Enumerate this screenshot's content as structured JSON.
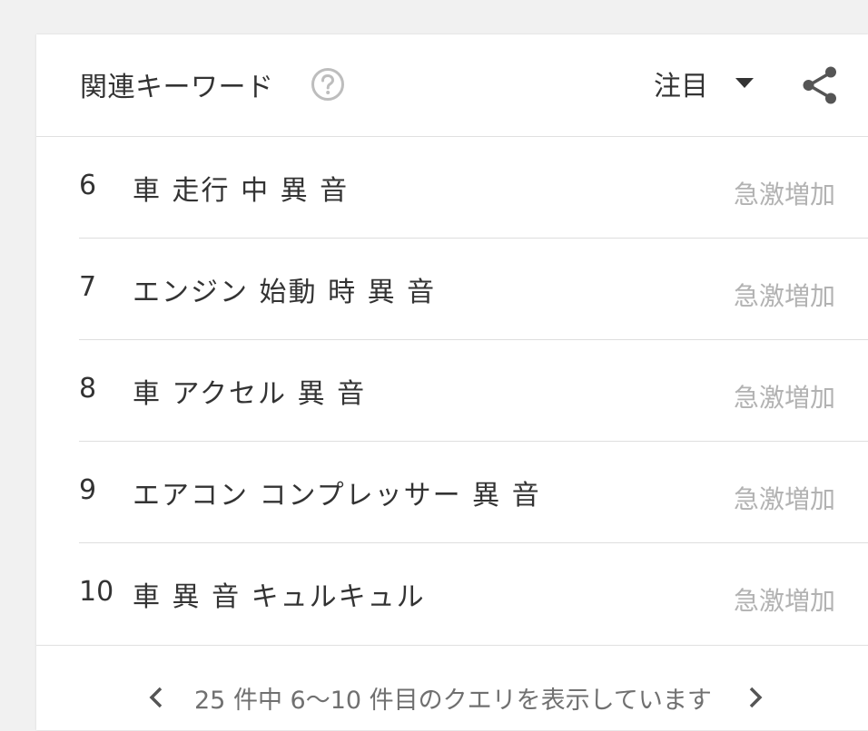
{
  "header": {
    "title": "関連キーワード",
    "help_icon": "help-circle-icon",
    "filter_label": "注目",
    "caret_icon": "caret-down-icon",
    "share_icon": "share-icon"
  },
  "rows": [
    {
      "rank": "6",
      "query": "車 走行 中 異 音",
      "value": "急激増加"
    },
    {
      "rank": "7",
      "query": "エンジン 始動 時 異 音",
      "value": "急激増加"
    },
    {
      "rank": "8",
      "query": "車 アクセル 異 音",
      "value": "急激増加"
    },
    {
      "rank": "9",
      "query": "エアコン コンプレッサー 異 音",
      "value": "急激増加"
    },
    {
      "rank": "10",
      "query": "車 異 音 キュルキュル",
      "value": "急激増加"
    }
  ],
  "footer": {
    "prev_icon": "chevron-left-icon",
    "next_icon": "chevron-right-icon",
    "pagination_text": "25 件中 6〜10 件目のクエリを表示しています"
  },
  "colors": {
    "background": "#f1f1f1",
    "card": "#ffffff",
    "text": "#333333",
    "muted": "#b2b2b2",
    "icon": "#707070"
  }
}
